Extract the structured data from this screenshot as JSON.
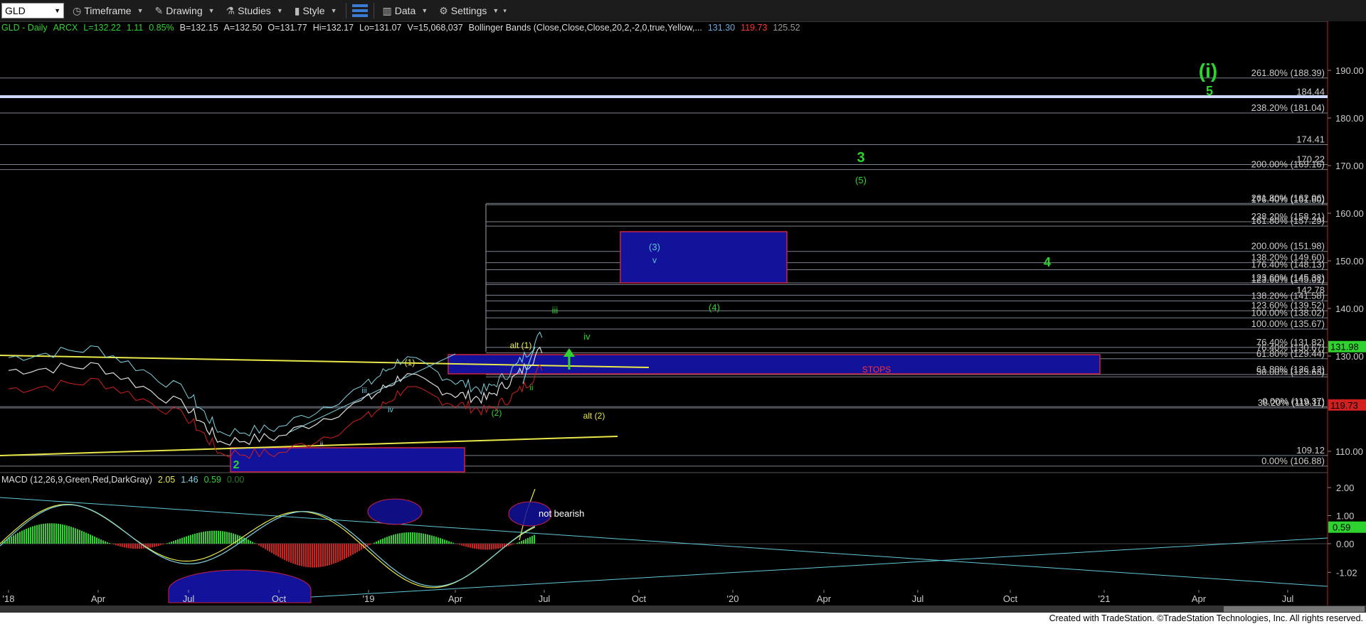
{
  "toolbar": {
    "symbol": "GLD",
    "timeframe_label": "Timeframe",
    "drawing_label": "Drawing",
    "studies_label": "Studies",
    "style_label": "Style",
    "data_label": "Data",
    "settings_label": "Settings"
  },
  "info": {
    "symbol": "GLD - Daily",
    "exchange": "ARCX",
    "last": "L=132.22",
    "change": "1.11",
    "pct": "0.85%",
    "bid": "B=132.15",
    "ask": "A=132.50",
    "open": "O=131.77",
    "high": "Hi=132.17",
    "low": "Lo=131.07",
    "volume": "V=15,068,037",
    "bb_label": "Bollinger Bands (Close,Close,Close,20,2,-2,0,true,Yellow,...",
    "bb_mid": "131.30",
    "bb_low": "119.73",
    "bb_extra": "125.52"
  },
  "macd_info": {
    "label": "MACD (12,26,9,Green,Red,DarkGray)",
    "v1": "2.05",
    "v2": "1.46",
    "v3": "0.59",
    "v4": "0.00"
  },
  "colors": {
    "green": "#2fd32f",
    "yellow": "#e8e84a",
    "cyan": "#5fc8d8",
    "blue_box": "#12129a",
    "red_box": "#cc2244",
    "bb_red": "#d02020",
    "bb_cyan": "#7fd4e0"
  },
  "footer": "Created with TradeStation. ©TradeStation Technologies, Inc. All rights reserved.",
  "chart_data": [
    {
      "type": "line",
      "title": "GLD - Daily",
      "ylim": [
        105,
        195
      ],
      "y_ticks": [
        "190.00",
        "180.00",
        "170.00",
        "160.00",
        "150.00",
        "140.00",
        "130.00",
        "110.00"
      ],
      "x_ticks": [
        "'18",
        "Apr",
        "Jul",
        "Oct",
        "'19",
        "Apr",
        "Jul",
        "Oct",
        "'20",
        "Apr",
        "Jul",
        "Oct",
        "'21",
        "Apr",
        "Jul"
      ],
      "price_tags": [
        {
          "label": "131.98",
          "value": 131.98,
          "color": "#2fd32f"
        },
        {
          "label": "119.73",
          "value": 119.73,
          "color": "#d02020"
        }
      ],
      "price_approx": [
        {
          "t": "'18",
          "v": 127
        },
        {
          "t": "Apr",
          "v": 128
        },
        {
          "t": "Jul",
          "v": 119
        },
        {
          "t": "Aug",
          "v": 112
        },
        {
          "t": "Oct",
          "v": 113
        },
        {
          "t": "'19",
          "v": 121
        },
        {
          "t": "Feb",
          "v": 126
        },
        {
          "t": "Apr",
          "v": 122
        },
        {
          "t": "May",
          "v": 121
        },
        {
          "t": "Jun",
          "v": 126
        },
        {
          "t": "Jul",
          "v": 132
        }
      ],
      "fib_levels": [
        {
          "label": "261.80% (188.39)",
          "value": 188.39
        },
        {
          "label": "184.44",
          "value": 184.44
        },
        {
          "label": "238.20% (181.04)",
          "value": 181.04
        },
        {
          "label": "174.41",
          "value": 174.41
        },
        {
          "label": "170.22",
          "value": 170.22
        },
        {
          "label": "200.00% (169.16)",
          "value": 169.16
        },
        {
          "label": "261.80% (162.06)",
          "value": 162.06
        },
        {
          "label": "176.40% (161.80)",
          "value": 161.8
        },
        {
          "label": "238.20% (158.21)",
          "value": 158.21
        },
        {
          "label": "161.80% (157.29)",
          "value": 157.29
        },
        {
          "label": "200.00% (151.98)",
          "value": 151.98
        },
        {
          "label": "138.20% (149.60)",
          "value": 149.6
        },
        {
          "label": "176.40% (148.13)",
          "value": 148.13
        },
        {
          "label": "123.60% (145.38)",
          "value": 145.38
        },
        {
          "label": "123.60% (145.01)",
          "value": 145.01
        },
        {
          "label": "142.78",
          "value": 142.78
        },
        {
          "label": "138.20% (141.58)",
          "value": 141.58
        },
        {
          "label": "123.60% (139.52)",
          "value": 139.52
        },
        {
          "label": "100.00% (138.02)",
          "value": 138.02
        },
        {
          "label": "100.00% (135.67)",
          "value": 135.67
        },
        {
          "label": "76.40% (131.82)",
          "value": 131.82
        },
        {
          "label": "76.40% (130.67)",
          "value": 130.67
        },
        {
          "label": "61.80% (129.44)",
          "value": 129.44
        },
        {
          "label": "61.80% (126.12)",
          "value": 126.12
        },
        {
          "label": "50.00% (125.63)",
          "value": 125.63
        },
        {
          "label": "0.00% (119.37)",
          "value": 119.37
        },
        {
          "label": "38.20% (119.11)",
          "value": 119.11
        },
        {
          "label": "109.12",
          "value": 109.12
        },
        {
          "label": "0.00% (106.88)",
          "value": 106.88
        }
      ],
      "wave_labels": [
        {
          "text": "(i)",
          "color": "#2fd32f"
        },
        {
          "text": "5",
          "color": "#2fd32f"
        },
        {
          "text": "3",
          "color": "#2fd32f"
        },
        {
          "text": "(5)",
          "color": "#2fd32f"
        },
        {
          "text": "(3)",
          "color": "#5fc8d8"
        },
        {
          "text": "v",
          "color": "#5fc8d8"
        },
        {
          "text": "4",
          "color": "#2fd32f"
        },
        {
          "text": "(4)",
          "color": "#2fd32f"
        },
        {
          "text": "iii",
          "color": "#2fd32f"
        },
        {
          "text": "iv",
          "color": "#2fd32f"
        },
        {
          "text": "alt (1)",
          "color": "#e8e84a"
        },
        {
          "text": "alt (2)",
          "color": "#e8e84a"
        },
        {
          "text": "(1)",
          "color": "#e8e84a"
        },
        {
          "text": "(2)",
          "color": "#2fd32f"
        },
        {
          "text": "2",
          "color": "#2fd32f"
        },
        {
          "text": "STOPS",
          "color": "#ff3333"
        },
        {
          "text": "iii",
          "color": "#5fc8d8"
        },
        {
          "text": "iv",
          "color": "#5fc8d8"
        },
        {
          "text": "ii",
          "color": "#ddd"
        },
        {
          "text": "i",
          "color": "#5fc8d8"
        },
        {
          "text": "ii",
          "color": "#2fd32f"
        }
      ]
    },
    {
      "type": "line",
      "title": "MACD (12,26,9,Green,Red,DarkGray)",
      "ylim": [
        -1.4,
        2.4
      ],
      "y_ticks": [
        "2.00",
        "1.00",
        "0.00",
        "-1.02"
      ],
      "last_value_tag": "0.59",
      "annotation": "not bearish"
    }
  ]
}
